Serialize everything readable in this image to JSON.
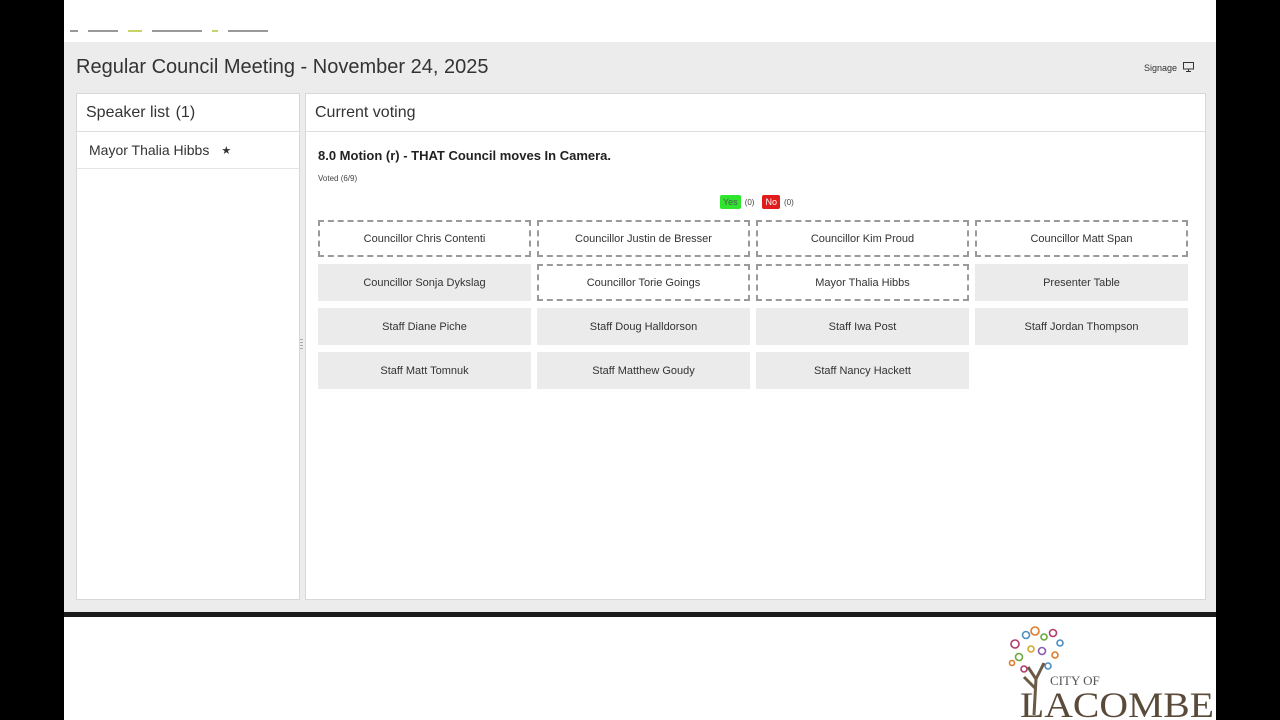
{
  "meeting": {
    "title": "Regular Council Meeting - November 24, 2025"
  },
  "header": {
    "signage_label": "Signage",
    "signage_icon": "monitor-icon"
  },
  "speaker_list": {
    "title": "Speaker list",
    "count": "(1)",
    "items": [
      {
        "name": "Mayor Thalia Hibbs",
        "marker": "★"
      }
    ]
  },
  "voting": {
    "title": "Current voting",
    "motion": "8.0 Motion (r) - THAT Council moves In Camera.",
    "voted": "Voted (6/9)",
    "yes_label": "Yes",
    "yes_count": "(0)",
    "no_label": "No",
    "no_count": "(0)",
    "participants": [
      {
        "name": "Councillor Chris Contenti",
        "pending": true
      },
      {
        "name": "Councillor Justin de Bresser",
        "pending": true
      },
      {
        "name": "Councillor Kim Proud",
        "pending": true
      },
      {
        "name": "Councillor Matt Span",
        "pending": true
      },
      {
        "name": "Councillor Sonja Dykslag",
        "pending": false
      },
      {
        "name": "Councillor Torie Goings",
        "pending": true
      },
      {
        "name": "Mayor Thalia Hibbs",
        "pending": true
      },
      {
        "name": "Presenter Table",
        "pending": false
      },
      {
        "name": "Staff Diane Piche",
        "pending": false
      },
      {
        "name": "Staff Doug Halldorson",
        "pending": false
      },
      {
        "name": "Staff Iwa Post",
        "pending": false
      },
      {
        "name": "Staff Jordan Thompson",
        "pending": false
      },
      {
        "name": "Staff Matt Tomnuk",
        "pending": false
      },
      {
        "name": "Staff Matthew Goudy",
        "pending": false
      },
      {
        "name": "Staff Nancy Hackett",
        "pending": false
      }
    ]
  },
  "branding": {
    "line1": "CITY OF",
    "line2": "LACOMBE"
  },
  "colors": {
    "yes": "#2ee62e",
    "no": "#e01c1c",
    "app_bg": "#ececec"
  }
}
